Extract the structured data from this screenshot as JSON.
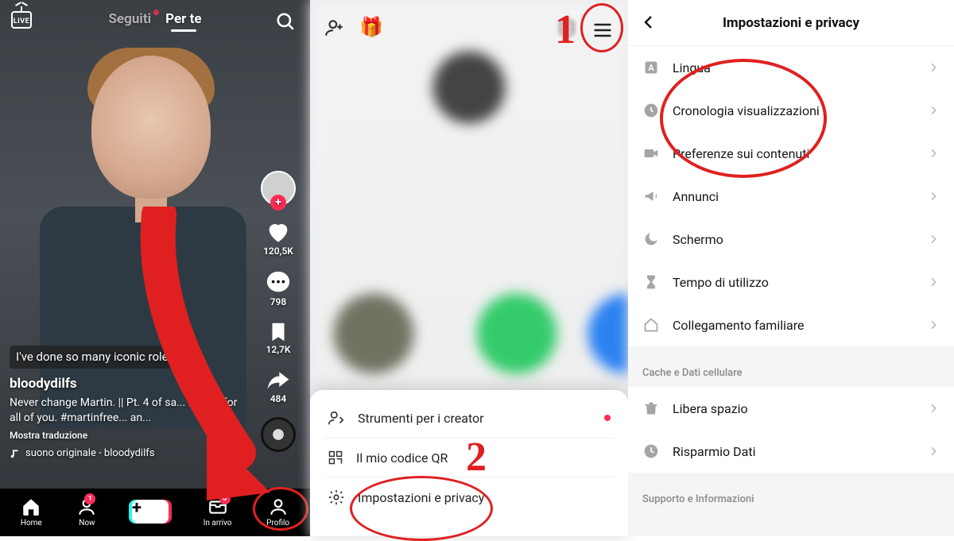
{
  "panel1": {
    "live_label": "LIVE",
    "tabs": {
      "following": "Seguiti",
      "for_you": "Per te"
    },
    "rail": {
      "likes": "120,5K",
      "comments": "798",
      "bookmarks": "12,7K",
      "shares": "484"
    },
    "subtitle": "I've done so many iconic roles.",
    "username": "bloodydilfs",
    "caption": "Never change Martin. || Pt. 4 of sa... Martin for all of you. #martinfree... an...",
    "translate": "Mostra traduzione",
    "sound": "suono originale - bloodydilfs",
    "tabbar": {
      "home": "Home",
      "now": "Now",
      "inbox": "In arrivo",
      "profile": "Profilo",
      "now_badge": "1",
      "inbox_badge": "6"
    }
  },
  "panel2": {
    "sheet": {
      "creator_tools": "Strumenti per i creator",
      "my_qr": "Il mio codice QR",
      "settings": "Impostazioni e privacy"
    },
    "ann1": "1",
    "ann2": "2"
  },
  "panel3": {
    "title": "Impostazioni e privacy",
    "rows": {
      "language": "Lingua",
      "history": "Cronologia visualizzazioni",
      "content_pref": "Preferenze sui contenuti",
      "ads": "Annunci",
      "display": "Schermo",
      "screen_time": "Tempo di utilizzo",
      "family": "Collegamento familiare",
      "free_space": "Libera spazio",
      "data_saver": "Risparmio Dati"
    },
    "section_cache": "Cache e Dati cellulare",
    "section_support": "Supporto e Informazioni"
  }
}
